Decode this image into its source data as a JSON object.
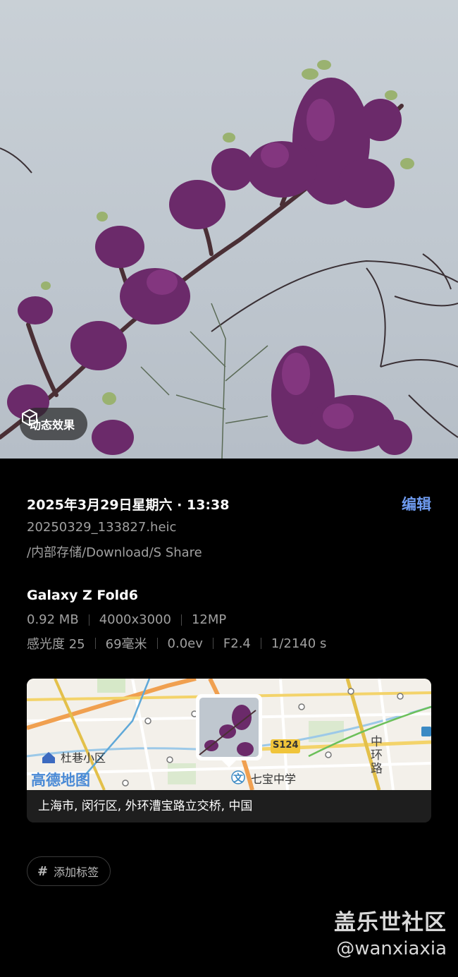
{
  "photo": {
    "motion_label": "动态效果"
  },
  "info": {
    "date_time": "2025年3月29日星期六 · 13:38",
    "edit_label": "编辑",
    "filename": "20250329_133827.heic",
    "path": "/内部存储/Download/S Share",
    "device": "Galaxy Z Fold6",
    "specs_row1": [
      "0.92 MB",
      "4000x3000",
      "12MP"
    ],
    "specs_row2": [
      "感光度 25",
      "69毫米",
      "0.0ev",
      "F2.4",
      "1/2140 s"
    ]
  },
  "map": {
    "labels": {
      "district": "杜巷小区",
      "provider": "高德地图",
      "school": "七宝中学",
      "road_badge": "S124",
      "ring_road": "中环路"
    },
    "address": "上海市, 闵行区, 外环漕宝路立交桥, 中国"
  },
  "tags": {
    "add_label": "添加标签"
  },
  "watermark": {
    "line1": "盖乐世社区",
    "line2": "@wanxiaxia"
  },
  "colors": {
    "accent": "#6e9bf0",
    "background": "#000000",
    "secondary_text": "#a0a0a0"
  }
}
